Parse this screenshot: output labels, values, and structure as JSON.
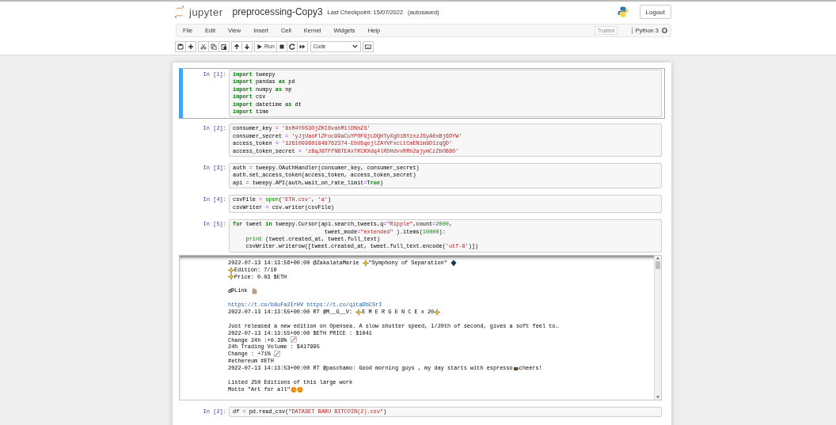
{
  "header": {
    "logo_text": "jupyter",
    "notebook_name": "preprocessing-Copy3",
    "checkpoint": "Last Checkpoint: 15/07/2022",
    "autosave": "(autosaved)",
    "logout": "Logout"
  },
  "menu": {
    "items": [
      "File",
      "Edit",
      "View",
      "Insert",
      "Cell",
      "Kernel",
      "Widgets",
      "Help"
    ],
    "trusted": "Trusted",
    "kernel": "Python 3",
    "kernel_busy": false
  },
  "toolbar": {
    "run": "Run",
    "cell_type": "Code"
  },
  "cells": [
    {
      "prompt": "In [1]:",
      "selected": true,
      "lines": [
        [
          {
            "kind": "keyword",
            "text": "import"
          },
          " tweepy"
        ],
        [
          {
            "kind": "keyword",
            "text": "import"
          },
          " pandas ",
          {
            "kind": "keyword",
            "text": "as"
          },
          " pd"
        ],
        [
          {
            "kind": "keyword",
            "text": "import"
          },
          " numpy ",
          {
            "kind": "keyword",
            "text": "as"
          },
          " np"
        ],
        [
          {
            "kind": "keyword",
            "text": "import"
          },
          " csv"
        ],
        [
          {
            "kind": "keyword",
            "text": "import"
          },
          " datetime ",
          {
            "kind": "keyword",
            "text": "as"
          },
          " dt"
        ],
        [
          {
            "kind": "keyword",
            "text": "import"
          },
          " time"
        ]
      ]
    },
    {
      "prompt": "In [2]:",
      "selected": false,
      "lines": [
        [
          "consumer_key ",
          {
            "kind": "operator",
            "text": "= "
          },
          {
            "kind": "string",
            "text": "'8sM4Y0S3OjZKI6vahM1lDNnZS'"
          }
        ],
        [
          "consumer_secret ",
          {
            "kind": "operator",
            "text": "= "
          },
          {
            "kind": "string",
            "text": "'yJjUaoFlZFoc99aCuYPOFGjLDQHTyXgOiBYzxzJSyA0xBj6DYW'"
          }
        ],
        [
          "access_token ",
          {
            "kind": "operator",
            "text": "= "
          },
          {
            "kind": "string",
            "text": "'1261099601848762374-EbU5qojlZAYVFxcLtCmEN1m9D1zqQD'"
          }
        ],
        [
          "access_token_secret ",
          {
            "kind": "operator",
            "text": "= "
          },
          {
            "kind": "string",
            "text": "'zBqJ8TFfNBTEAxTKCKXdq4lRDHdvvRRh2ajymCzZbOB80'"
          }
        ]
      ]
    },
    {
      "prompt": "In [3]:",
      "selected": false,
      "lines": [
        [
          "auth ",
          {
            "kind": "operator",
            "text": "="
          },
          " tweepy.OAuthHandler(consumer_key, consumer_secret)"
        ],
        [
          "auth.set_access_token(access_token, access_token_secret)"
        ],
        [
          "api ",
          {
            "kind": "operator",
            "text": "="
          },
          " tweepy.API(auth,wait_on_rate_limit",
          {
            "kind": "operator",
            "text": "="
          },
          {
            "kind": "keyword",
            "text": "True"
          },
          ")"
        ]
      ]
    },
    {
      "prompt": "In [4]:",
      "selected": false,
      "lines": [
        [
          "csvFile ",
          {
            "kind": "operator",
            "text": "= "
          },
          {
            "kind": "builtin",
            "text": "open"
          },
          "(",
          {
            "kind": "string",
            "text": "'ETH.csv'"
          },
          ", ",
          {
            "kind": "string",
            "text": "'a'"
          },
          ")"
        ],
        [
          "csvWriter ",
          {
            "kind": "operator",
            "text": "="
          },
          " csv.writer(csvFile)"
        ]
      ]
    },
    {
      "prompt": "In [5]:",
      "selected": false,
      "lines": [
        [
          {
            "kind": "keyword",
            "text": "for"
          },
          " tweet ",
          {
            "kind": "keyword",
            "text": "in"
          },
          " tweepy.Cursor(api.search_tweets,q",
          {
            "kind": "operator",
            "text": "="
          },
          {
            "kind": "string",
            "text": "\"Ripple\""
          },
          ",count",
          {
            "kind": "operator",
            "text": "="
          },
          {
            "kind": "number",
            "text": "2000"
          },
          ","
        ],
        [
          "                            tweet_mode",
          {
            "kind": "operator",
            "text": "="
          },
          {
            "kind": "string",
            "text": "\"extended\""
          },
          " ).items(",
          {
            "kind": "number",
            "text": "10000"
          },
          "):"
        ],
        [
          {
            "kind": "builtin",
            "text": "    print"
          },
          " (tweet.created_at, tweet.full_text)"
        ],
        [
          "    csvWriter.writerow([tweet.created_at, tweet.full_text.encode(",
          {
            "kind": "string",
            "text": "'utf-8'"
          },
          ")])"
        ]
      ],
      "output": {
        "paragraphs": [
          [
            [
              "2022-07-13 14:13:56+00:00 @ZakalataMarie ",
              {
                "kind": "sparkles"
              },
              "\"Symphony of Separation\" ",
              {
                "kind": "diamond"
              }
            ],
            [
              {
                "kind": "sparkles"
              },
              "Edition: 7/10"
            ],
            [
              {
                "kind": "sparkles"
              },
              "Price: 0.03 $ETH"
            ]
          ],
          [
            [
              {
                "kind": "link"
              },
              "Link ",
              {
                "kind": "hand"
              }
            ]
          ],
          [
            [
              {
                "kind": "url",
                "text": "https://t.co/b8uFa2IrHV https://t.co/qitaDbCSrI"
              }
            ],
            [
              "2022-07-13 14:13:55+00:00 RT @M__G__V: ",
              {
                "kind": "sparkles"
              },
              "E M E R G E N C E x 20",
              {
                "kind": "sparkles"
              }
            ]
          ],
          [
            [
              "Just released a new edition on Opensea. A slow shutter speed, 1/20th of second, gives a soft feel to…"
            ],
            [
              "2022-07-13 14:13:55+00:00 $ETH PRICE : $1041"
            ],
            [
              "Change 24h :+0.39% ",
              {
                "kind": "chart"
              }
            ],
            [
              "24h Trading Volume : $417995"
            ],
            [
              "Change : +71% ",
              {
                "kind": "chart"
              }
            ],
            [
              "#ethereum #ETH"
            ],
            [
              "2022-07-13 14:13:53+00:00 RT @paschamo: Good morning guys , my day starts with espresso",
              {
                "kind": "cup"
              },
              "cheers!"
            ]
          ],
          [
            [
              "Listed 250 Editions of this large work"
            ],
            [
              "Motto \"Art for all\"",
              {
                "kind": "face"
              },
              {
                "kind": "face"
              }
            ]
          ]
        ]
      }
    },
    {
      "prompt": "In [2]:",
      "selected": false,
      "lines": [
        [
          "df ",
          {
            "kind": "operator",
            "text": "="
          },
          " pd.read_csv(",
          {
            "kind": "string",
            "text": "\"DATASET BARU BITCOIN(2).csv\""
          },
          ")"
        ]
      ]
    }
  ]
}
